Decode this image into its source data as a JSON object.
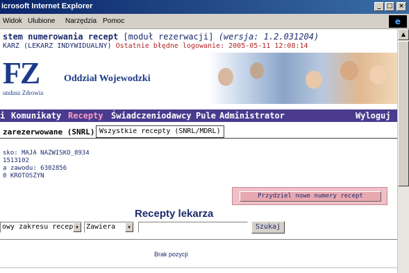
{
  "window": {
    "title": "icrosoft Internet Explorer",
    "controls": {
      "minimize": "_",
      "maximize": "□",
      "close": "×"
    }
  },
  "menu": [
    "Widok",
    "Ulubione",
    "Narzędzia",
    "Pomoc"
  ],
  "header": {
    "system_title": "stem numerowania recept",
    "module": "[moduł rezerwacji]",
    "version": "(wersja: 1.2.031204)",
    "user_prefix": "KARZ (LEKARZ INDYWIDUALNY)",
    "last_login": "Ostatnie błędne logowanie: 2005-05-11 12:08:14"
  },
  "banner": {
    "logo": "FZ",
    "logo_sub": "undusz Zdrowia",
    "department": "Oddział Wojewodzki"
  },
  "nav": {
    "items": [
      "i",
      "Komunikaty",
      "Recepty",
      "Świadczeniodawcy",
      "Pule",
      "Administrator"
    ],
    "active": "Recepty",
    "logout": "Wyloguj"
  },
  "tabs": {
    "active": "zarezerwowane (SNRL)",
    "other": "Wszystkie recepty (SNRL/MDRL)"
  },
  "doctor": {
    "name": "sko: MAJA NAZWISKO_8934",
    "id": "1513102",
    "license": "a zawodu: 6302856",
    "city": "0 KROTOSZYN"
  },
  "actions": {
    "assign_button": "Przydziel nowe numery recept"
  },
  "section_title": "Recepty lekarza",
  "search": {
    "field_select": "owy zakresu recept",
    "operator_select": "Zawiera",
    "query": "",
    "button": "Szukaj"
  },
  "results": {
    "empty_message": "Brak pozycji"
  },
  "icons": {
    "dropdown": "▾",
    "scroll_up": "▲",
    "ie_logo": "e"
  }
}
